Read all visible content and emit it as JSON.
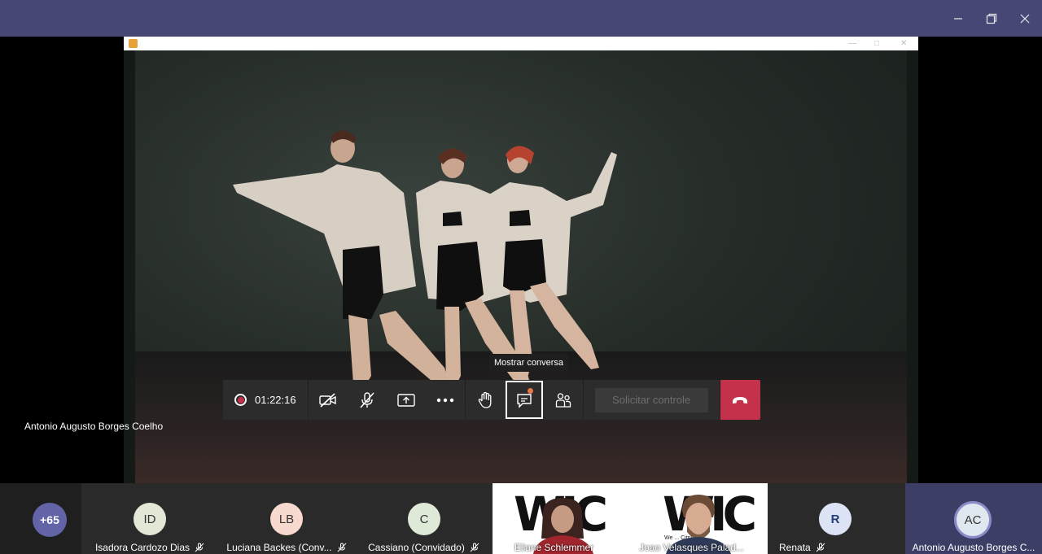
{
  "window": {
    "minimize_icon": "minimize-icon",
    "restore_icon": "restore-icon",
    "close_icon": "close-icon"
  },
  "shared_screen": {
    "presenter": "Antonio Augusto Borges Coelho"
  },
  "tooltip": "Mostrar conversa",
  "callbar": {
    "timer": "01:22:16",
    "request_control": "Solicitar controle",
    "buttons": [
      "video-off-icon",
      "mic-off-icon",
      "share-screen-icon",
      "more-icon",
      "raise-hand-icon",
      "chat-icon",
      "participants-icon",
      "hang-up-icon"
    ]
  },
  "participants": {
    "overflow": "+65",
    "tiles": [
      {
        "initials": "ID",
        "name": "Isadora Cardozo Dias",
        "avatar_color": "#e3e8d6"
      },
      {
        "initials": "LB",
        "name": "Luciana Backes (Conv...",
        "avatar_color": "#f7d9cf"
      },
      {
        "initials": "C",
        "name": "Cassiano (Convidado)",
        "avatar_color": "#dfe9d8"
      },
      {
        "initials": "",
        "name": "Eliane Schlemmer",
        "video": true
      },
      {
        "initials": "",
        "name": "Joao Velasques Palad...",
        "video": true
      },
      {
        "initials": "R",
        "name": "Renata",
        "avatar_color": "#dbe3f4"
      },
      {
        "initials": "AC",
        "name": "Antonio Augusto Borges C...",
        "avatar_color": "#e0e8ef"
      }
    ],
    "video_logo": "WIC",
    "video_tagline": "We ... Citricity"
  },
  "colors": {
    "titlebar": "#464775",
    "hangup": "#c4314b",
    "overflow_badge": "#6264a7"
  }
}
